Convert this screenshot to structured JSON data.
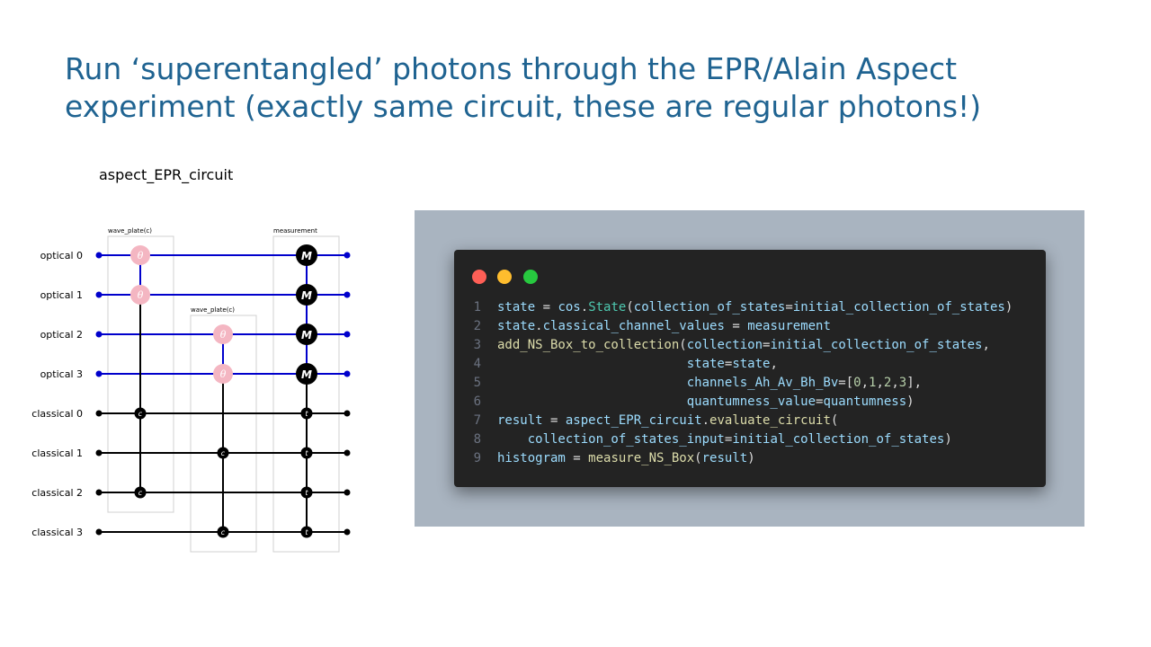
{
  "slide": {
    "title": "Run ‘superentangled’ photons through the EPR/Alain Aspect experiment (exactly same circuit, these are regular photons!)"
  },
  "circuit": {
    "title": "aspect_EPR_circuit",
    "nodes": [
      {
        "label": "optical 0",
        "type": "optical"
      },
      {
        "label": "optical 1",
        "type": "optical"
      },
      {
        "label": "optical 2",
        "type": "optical"
      },
      {
        "label": "optical 3",
        "type": "optical"
      },
      {
        "label": "classical 0",
        "type": "classical"
      },
      {
        "label": "classical 1",
        "type": "classical"
      },
      {
        "label": "classical 2",
        "type": "classical"
      },
      {
        "label": "classical 3",
        "type": "classical"
      }
    ],
    "boxes": [
      {
        "label": "wave_plate(c)",
        "rows": [
          0,
          6
        ],
        "col": 0
      },
      {
        "label": "wave_plate(c)",
        "rows": [
          2,
          7
        ],
        "col": 1
      },
      {
        "label": "measurement",
        "rows": [
          0,
          7
        ],
        "col": 2
      }
    ],
    "wave_gates": [
      {
        "optical": 0,
        "classical": 0,
        "col": 0
      },
      {
        "optical": 1,
        "classical": 2,
        "col": 0
      },
      {
        "optical": 2,
        "classical": 1,
        "col": 1
      },
      {
        "optical": 3,
        "classical": 3,
        "col": 1
      }
    ],
    "wave_gate_symbol": "θ",
    "control_symbol": "c",
    "measure_symbol": "M",
    "target_symbol": "t",
    "colors": {
      "optical_wire": "#0000cc",
      "classical_wire": "#000000",
      "wave_gate": "#f4b6c2",
      "box_border": "#d0d0d0"
    }
  },
  "code": {
    "window_dots": [
      "#ff5f56",
      "#ffbd2e",
      "#27c93f"
    ],
    "lines": [
      {
        "num": "1",
        "tokens": [
          {
            "t": "state",
            "c": "v"
          },
          {
            "t": " = ",
            "c": "p"
          },
          {
            "t": "cos",
            "c": "v"
          },
          {
            "t": ".",
            "c": "p"
          },
          {
            "t": "State",
            "c": "c"
          },
          {
            "t": "(",
            "c": "p"
          },
          {
            "t": "collection_of_states",
            "c": "v"
          },
          {
            "t": "=",
            "c": "p"
          },
          {
            "t": "initial_collection_of_states",
            "c": "v"
          },
          {
            "t": ")",
            "c": "p"
          }
        ]
      },
      {
        "num": "2",
        "tokens": [
          {
            "t": "state",
            "c": "v"
          },
          {
            "t": ".",
            "c": "p"
          },
          {
            "t": "classical_channel_values",
            "c": "v"
          },
          {
            "t": " = ",
            "c": "p"
          },
          {
            "t": "measurement",
            "c": "v"
          }
        ]
      },
      {
        "num": "3",
        "tokens": [
          {
            "t": "add_NS_Box_to_collection",
            "c": "f"
          },
          {
            "t": "(",
            "c": "p"
          },
          {
            "t": "collection",
            "c": "v"
          },
          {
            "t": "=",
            "c": "p"
          },
          {
            "t": "initial_collection_of_states",
            "c": "v"
          },
          {
            "t": ",",
            "c": "p"
          }
        ]
      },
      {
        "num": "4",
        "tokens": [
          {
            "t": "                         ",
            "c": "p"
          },
          {
            "t": "state",
            "c": "v"
          },
          {
            "t": "=",
            "c": "p"
          },
          {
            "t": "state",
            "c": "v"
          },
          {
            "t": ",",
            "c": "p"
          }
        ]
      },
      {
        "num": "5",
        "tokens": [
          {
            "t": "                         ",
            "c": "p"
          },
          {
            "t": "channels_Ah_Av_Bh_Bv",
            "c": "v"
          },
          {
            "t": "=[",
            "c": "p"
          },
          {
            "t": "0",
            "c": "n"
          },
          {
            "t": ",",
            "c": "p"
          },
          {
            "t": "1",
            "c": "n"
          },
          {
            "t": ",",
            "c": "p"
          },
          {
            "t": "2",
            "c": "n"
          },
          {
            "t": ",",
            "c": "p"
          },
          {
            "t": "3",
            "c": "n"
          },
          {
            "t": "],",
            "c": "p"
          }
        ]
      },
      {
        "num": "6",
        "tokens": [
          {
            "t": "                         ",
            "c": "p"
          },
          {
            "t": "quantumness_value",
            "c": "v"
          },
          {
            "t": "=",
            "c": "p"
          },
          {
            "t": "quantumness",
            "c": "v"
          },
          {
            "t": ")",
            "c": "p"
          }
        ]
      },
      {
        "num": "7",
        "tokens": [
          {
            "t": "result",
            "c": "v"
          },
          {
            "t": " = ",
            "c": "p"
          },
          {
            "t": "aspect_EPR_circuit",
            "c": "v"
          },
          {
            "t": ".",
            "c": "p"
          },
          {
            "t": "evaluate_circuit",
            "c": "f"
          },
          {
            "t": "(",
            "c": "p"
          }
        ]
      },
      {
        "num": "8",
        "tokens": [
          {
            "t": "    ",
            "c": "p"
          },
          {
            "t": "collection_of_states_input",
            "c": "v"
          },
          {
            "t": "=",
            "c": "p"
          },
          {
            "t": "initial_collection_of_states",
            "c": "v"
          },
          {
            "t": ")",
            "c": "p"
          }
        ]
      },
      {
        "num": "9",
        "tokens": [
          {
            "t": "histogram",
            "c": "v"
          },
          {
            "t": " = ",
            "c": "p"
          },
          {
            "t": "measure_NS_Box",
            "c": "f"
          },
          {
            "t": "(",
            "c": "p"
          },
          {
            "t": "result",
            "c": "v"
          },
          {
            "t": ")",
            "c": "p"
          }
        ]
      }
    ]
  }
}
